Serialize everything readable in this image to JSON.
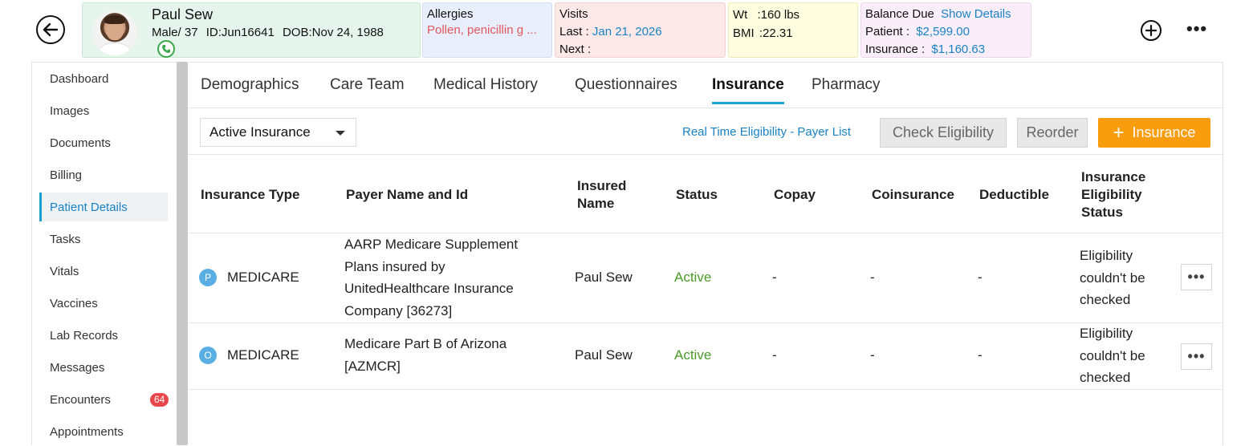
{
  "header": {
    "patient": {
      "name": "Paul Sew",
      "gender_age": "Male/ 37",
      "id": "ID:Jun16641",
      "dob": "DOB:Nov 24, 1988"
    },
    "allergies": {
      "label": "Allergies",
      "value": "Pollen, penicillin g ..."
    },
    "visits": {
      "label": "Visits",
      "last_label": "Last :",
      "last_value": "Jan 21, 2026",
      "next_label": "Next :"
    },
    "vitals": {
      "wt_label": "Wt",
      "wt_value": ":160 lbs",
      "bmi_label": "BMI",
      "bmi_value": ":22.31"
    },
    "balance": {
      "label": "Balance Due",
      "show_details": "Show Details",
      "patient_label": "Patient :",
      "patient_value": "$2,599.00",
      "insurance_label": "Insurance :",
      "insurance_value": "$1,160.63"
    }
  },
  "sidebar": {
    "items": [
      {
        "label": "Dashboard"
      },
      {
        "label": "Images"
      },
      {
        "label": "Documents"
      },
      {
        "label": "Billing"
      },
      {
        "label": "Patient Details",
        "active": true
      },
      {
        "label": "Tasks"
      },
      {
        "label": "Vitals"
      },
      {
        "label": "Vaccines"
      },
      {
        "label": "Lab Records"
      },
      {
        "label": "Messages"
      },
      {
        "label": "Encounters",
        "badge": "64"
      },
      {
        "label": "Appointments"
      }
    ]
  },
  "tabs": [
    {
      "label": "Demographics"
    },
    {
      "label": "Care Team"
    },
    {
      "label": "Medical History"
    },
    {
      "label": "Questionnaires"
    },
    {
      "label": "Insurance",
      "active": true
    },
    {
      "label": "Pharmacy"
    }
  ],
  "toolbar": {
    "filter_value": "Active Insurance",
    "rte_link": "Real Time Eligibility - Payer List",
    "check_eligibility": "Check Eligibility",
    "reorder": "Reorder",
    "add_insurance": "Insurance"
  },
  "table": {
    "headers": {
      "type": "Insurance Type",
      "payer": "Payer Name and Id",
      "insured_1": "Insured",
      "insured_2": "Name",
      "status": "Status",
      "copay": "Copay",
      "coinsurance": "Coinsurance",
      "deductible": "Deductible",
      "elig_1": "Insurance",
      "elig_2": "Eligibility",
      "elig_3": "Status"
    },
    "rows": [
      {
        "badge": "P",
        "type": "MEDICARE",
        "payer_lines": [
          "AARP Medicare Supplement",
          "Plans insured by",
          "UnitedHealthcare Insurance",
          "Company [36273]"
        ],
        "insured": "Paul Sew",
        "status": "Active",
        "copay": "-",
        "coinsurance": "-",
        "deductible": "-",
        "elig_lines": [
          "Eligibility",
          "couldn't be",
          "checked"
        ]
      },
      {
        "badge": "O",
        "type": "MEDICARE",
        "payer_lines": [
          "Medicare Part B of Arizona",
          "[AZMCR]"
        ],
        "insured": "Paul Sew",
        "status": "Active",
        "copay": "-",
        "coinsurance": "-",
        "deductible": "-",
        "elig_lines": [
          "Eligibility",
          "couldn't be",
          "checked"
        ]
      }
    ]
  }
}
